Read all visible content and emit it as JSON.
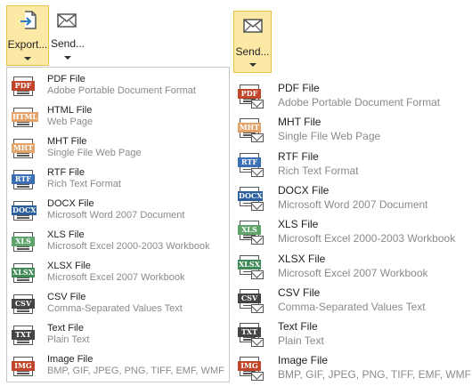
{
  "left_toolbar": {
    "export_label": "Export...",
    "send_label": "Send..."
  },
  "right_toolbar": {
    "send_label": "Send..."
  },
  "colors": {
    "active_button_bg": "#fde9a6",
    "active_button_border": "#e6c24a"
  },
  "export_menu": [
    {
      "tag": "PDF",
      "title": "PDF File",
      "desc": "Adobe Portable Document Format",
      "color": "#c0452b",
      "icon": "pdf-file-icon"
    },
    {
      "tag": "HTML",
      "title": "HTML File",
      "desc": "Web Page",
      "color": "#e3a368",
      "icon": "html-file-icon"
    },
    {
      "tag": "MHT",
      "title": "MHT File",
      "desc": "Single File Web Page",
      "color": "#e3a368",
      "icon": "mht-file-icon"
    },
    {
      "tag": "RTF",
      "title": "RTF File",
      "desc": "Rich Text Format",
      "color": "#3a6fb5",
      "icon": "rtf-file-icon"
    },
    {
      "tag": "DOCX",
      "title": "DOCX File",
      "desc": "Microsoft Word 2007 Document",
      "color": "#2a5e9c",
      "icon": "docx-file-icon"
    },
    {
      "tag": "XLS",
      "title": "XLS File",
      "desc": "Microsoft Excel 2000-2003 Workbook",
      "color": "#5fa46a",
      "icon": "xls-file-icon"
    },
    {
      "tag": "XLSX",
      "title": "XLSX File",
      "desc": "Microsoft Excel 2007 Workbook",
      "color": "#3f8a56",
      "icon": "xlsx-file-icon"
    },
    {
      "tag": "CSV",
      "title": "CSV File",
      "desc": "Comma-Separated Values Text",
      "color": "#444444",
      "icon": "csv-file-icon"
    },
    {
      "tag": "TXT",
      "title": "Text File",
      "desc": "Plain Text",
      "color": "#444444",
      "icon": "txt-file-icon"
    },
    {
      "tag": "IMG",
      "title": "Image File",
      "desc": "BMP, GIF, JPEG, PNG, TIFF, EMF, WMF",
      "color": "#c0452b",
      "icon": "image-file-icon"
    }
  ],
  "send_menu": [
    {
      "tag": "PDF",
      "title": "PDF File",
      "desc": "Adobe Portable Document Format",
      "color": "#c0452b",
      "icon": "pdf-file-mail-icon"
    },
    {
      "tag": "MHT",
      "title": "MHT File",
      "desc": "Single File Web Page",
      "color": "#e3a368",
      "icon": "mht-file-mail-icon"
    },
    {
      "tag": "RTF",
      "title": "RTF File",
      "desc": "Rich Text Format",
      "color": "#3a6fb5",
      "icon": "rtf-file-mail-icon"
    },
    {
      "tag": "DOCX",
      "title": "DOCX File",
      "desc": "Microsoft Word 2007 Document",
      "color": "#2a5e9c",
      "icon": "docx-file-mail-icon"
    },
    {
      "tag": "XLS",
      "title": "XLS File",
      "desc": "Microsoft Excel 2000-2003 Workbook",
      "color": "#5fa46a",
      "icon": "xls-file-mail-icon"
    },
    {
      "tag": "XLSX",
      "title": "XLSX File",
      "desc": "Microsoft Excel 2007 Workbook",
      "color": "#3f8a56",
      "icon": "xlsx-file-mail-icon"
    },
    {
      "tag": "CSV",
      "title": "CSV File",
      "desc": "Comma-Separated Values Text",
      "color": "#444444",
      "icon": "csv-file-mail-icon"
    },
    {
      "tag": "TXT",
      "title": "Text File",
      "desc": "Plain Text",
      "color": "#444444",
      "icon": "txt-file-mail-icon"
    },
    {
      "tag": "IMG",
      "title": "Image File",
      "desc": "BMP, GIF, JPEG, PNG, TIFF, EMF, WMF",
      "color": "#c0452b",
      "icon": "image-file-mail-icon"
    }
  ]
}
